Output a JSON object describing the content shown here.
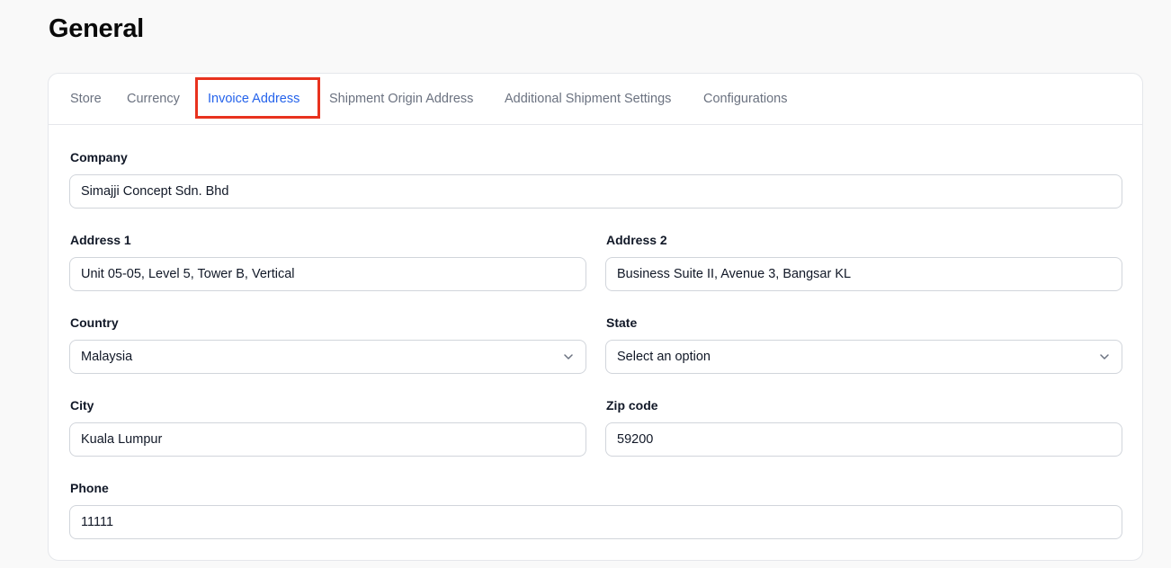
{
  "page": {
    "title": "General"
  },
  "tabs": [
    {
      "label": "Store",
      "active": false
    },
    {
      "label": "Currency",
      "active": false
    },
    {
      "label": "Invoice Address",
      "active": true
    },
    {
      "label": "Shipment Origin Address",
      "active": false
    },
    {
      "label": "Additional Shipment Settings",
      "active": false
    },
    {
      "label": "Configurations",
      "active": false
    }
  ],
  "form": {
    "company": {
      "label": "Company",
      "value": "Simajji Concept Sdn. Bhd"
    },
    "address1": {
      "label": "Address 1",
      "value": "Unit 05-05, Level 5, Tower B, Vertical"
    },
    "address2": {
      "label": "Address 2",
      "value": "Business Suite II, Avenue 3, Bangsar KL"
    },
    "country": {
      "label": "Country",
      "value": "Malaysia"
    },
    "state": {
      "label": "State",
      "value": "Select an option"
    },
    "city": {
      "label": "City",
      "value": "Kuala Lumpur"
    },
    "zip": {
      "label": "Zip code",
      "value": "59200"
    },
    "phone": {
      "label": "Phone",
      "value": "11111"
    }
  },
  "colors": {
    "active_tab": "#2563eb",
    "highlight_box": "#e8321e"
  },
  "icons": {
    "select_chevron": "chevron-down-icon"
  }
}
